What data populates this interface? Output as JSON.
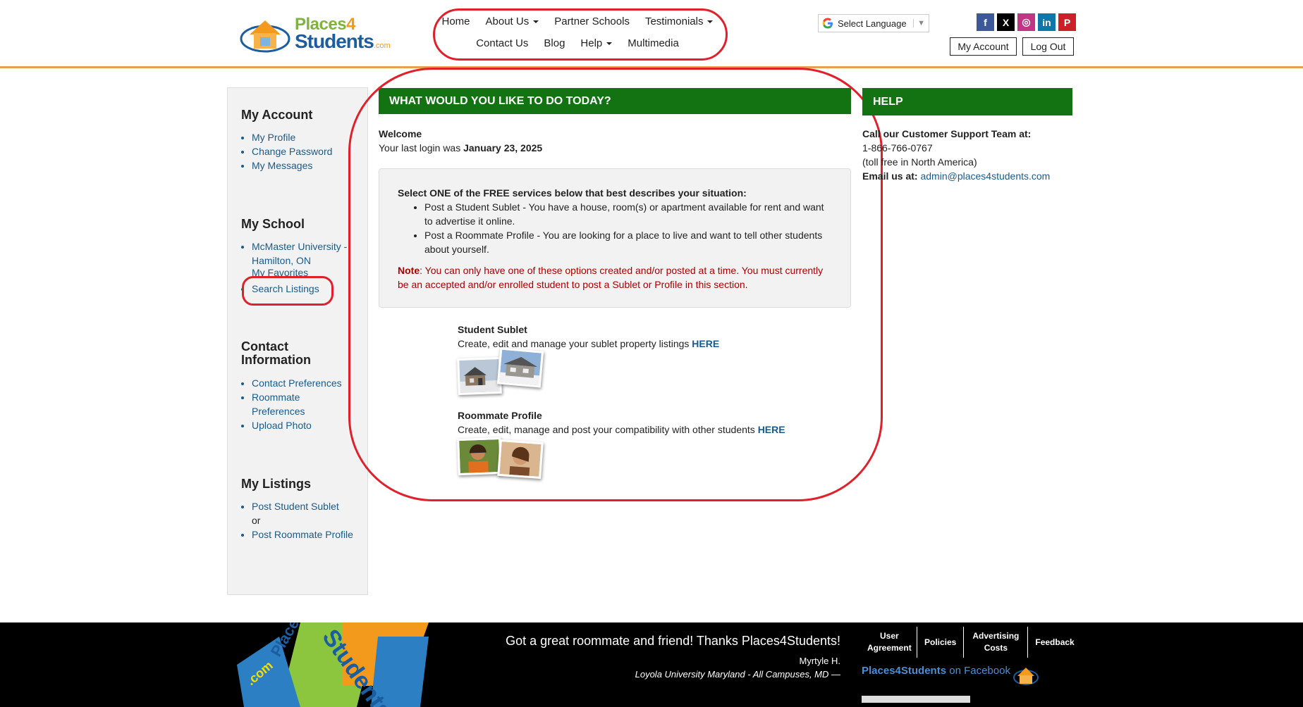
{
  "header": {
    "logo": {
      "line1_a": "Places",
      "line1_b": "4",
      "line2": "Students",
      "tld": ".com"
    },
    "nav_row1": [
      {
        "label": "Home",
        "dropdown": false
      },
      {
        "label": "About Us",
        "dropdown": true
      },
      {
        "label": "Partner Schools",
        "dropdown": false
      },
      {
        "label": "Testimonials",
        "dropdown": true
      }
    ],
    "nav_row2": [
      {
        "label": "Contact Us",
        "dropdown": false
      },
      {
        "label": "Blog",
        "dropdown": false
      },
      {
        "label": "Help",
        "dropdown": true
      },
      {
        "label": "Multimedia",
        "dropdown": false
      }
    ],
    "language_label": "Select Language",
    "my_account_btn": "My Account",
    "logout_btn": "Log Out",
    "social": [
      {
        "icon": "facebook-icon",
        "glyph": "f",
        "color": "#3b5998"
      },
      {
        "icon": "x-icon",
        "glyph": "X",
        "color": "#000000"
      },
      {
        "icon": "instagram-icon",
        "glyph": "◎",
        "color": "#c13584"
      },
      {
        "icon": "linkedin-icon",
        "glyph": "in",
        "color": "#0e76a8"
      },
      {
        "icon": "pinterest-icon",
        "glyph": "P",
        "color": "#cb2027"
      }
    ]
  },
  "sidebar": {
    "account": {
      "title": "My Account",
      "items": [
        "My Profile",
        "Change Password",
        "My Messages"
      ]
    },
    "school": {
      "title": "My School",
      "items": [
        "McMaster University - Hamilton, ON",
        "My Favorites",
        "Search Listings"
      ]
    },
    "contact": {
      "title": "Contact Information",
      "items": [
        "Contact Preferences",
        "Roommate Preferences",
        "Upload Photo"
      ]
    },
    "listings": {
      "title": "My Listings",
      "item1": "Post Student Sublet",
      "or": "or",
      "item2": "Post Roommate Profile"
    }
  },
  "main": {
    "heading": "WHAT WOULD YOU LIKE TO DO TODAY?",
    "welcome": "Welcome",
    "last_login_prefix": "Your last login was",
    "last_login_date": "January 23, 2025",
    "services_lead": "Select ONE of the FREE services below that best describes your situation:",
    "service1": "Post a Student Sublet - You have a house, room(s) or apartment available for rent and want to advertise it online.",
    "service2": "Post a Roommate Profile - You are looking for a place to live and want to tell other students about yourself.",
    "note_label": "Note",
    "note_text": ": You can only have one of these options created and/or posted at a time. You must currently be an accepted and/or enrolled student to post a Sublet or Profile in this section.",
    "sublet": {
      "title": "Student Sublet",
      "desc": "Create, edit and manage your sublet property listings",
      "link": "HERE"
    },
    "roommate": {
      "title": "Roommate Profile",
      "desc": "Create, edit, manage and post your compatibility with other students",
      "link": "HERE"
    }
  },
  "help": {
    "heading": "HELP",
    "call_label": "Call our Customer Support Team at:",
    "phone": "1-866-766-0767",
    "tollfree": "(toll free in North America)",
    "email_label": "Email us at:",
    "email": "admin@places4students.com"
  },
  "footer": {
    "quote": "Got a great roommate and friend! Thanks Places4Students!",
    "name": "Myrtyle H.",
    "school": "Loyola University Maryland - All Campuses, MD  —",
    "links": [
      "User Agreement",
      "Policies",
      "Advertising Costs",
      "Feedback"
    ],
    "fb_brand": "Places4Students",
    "fb_suffix": " on Facebook"
  }
}
